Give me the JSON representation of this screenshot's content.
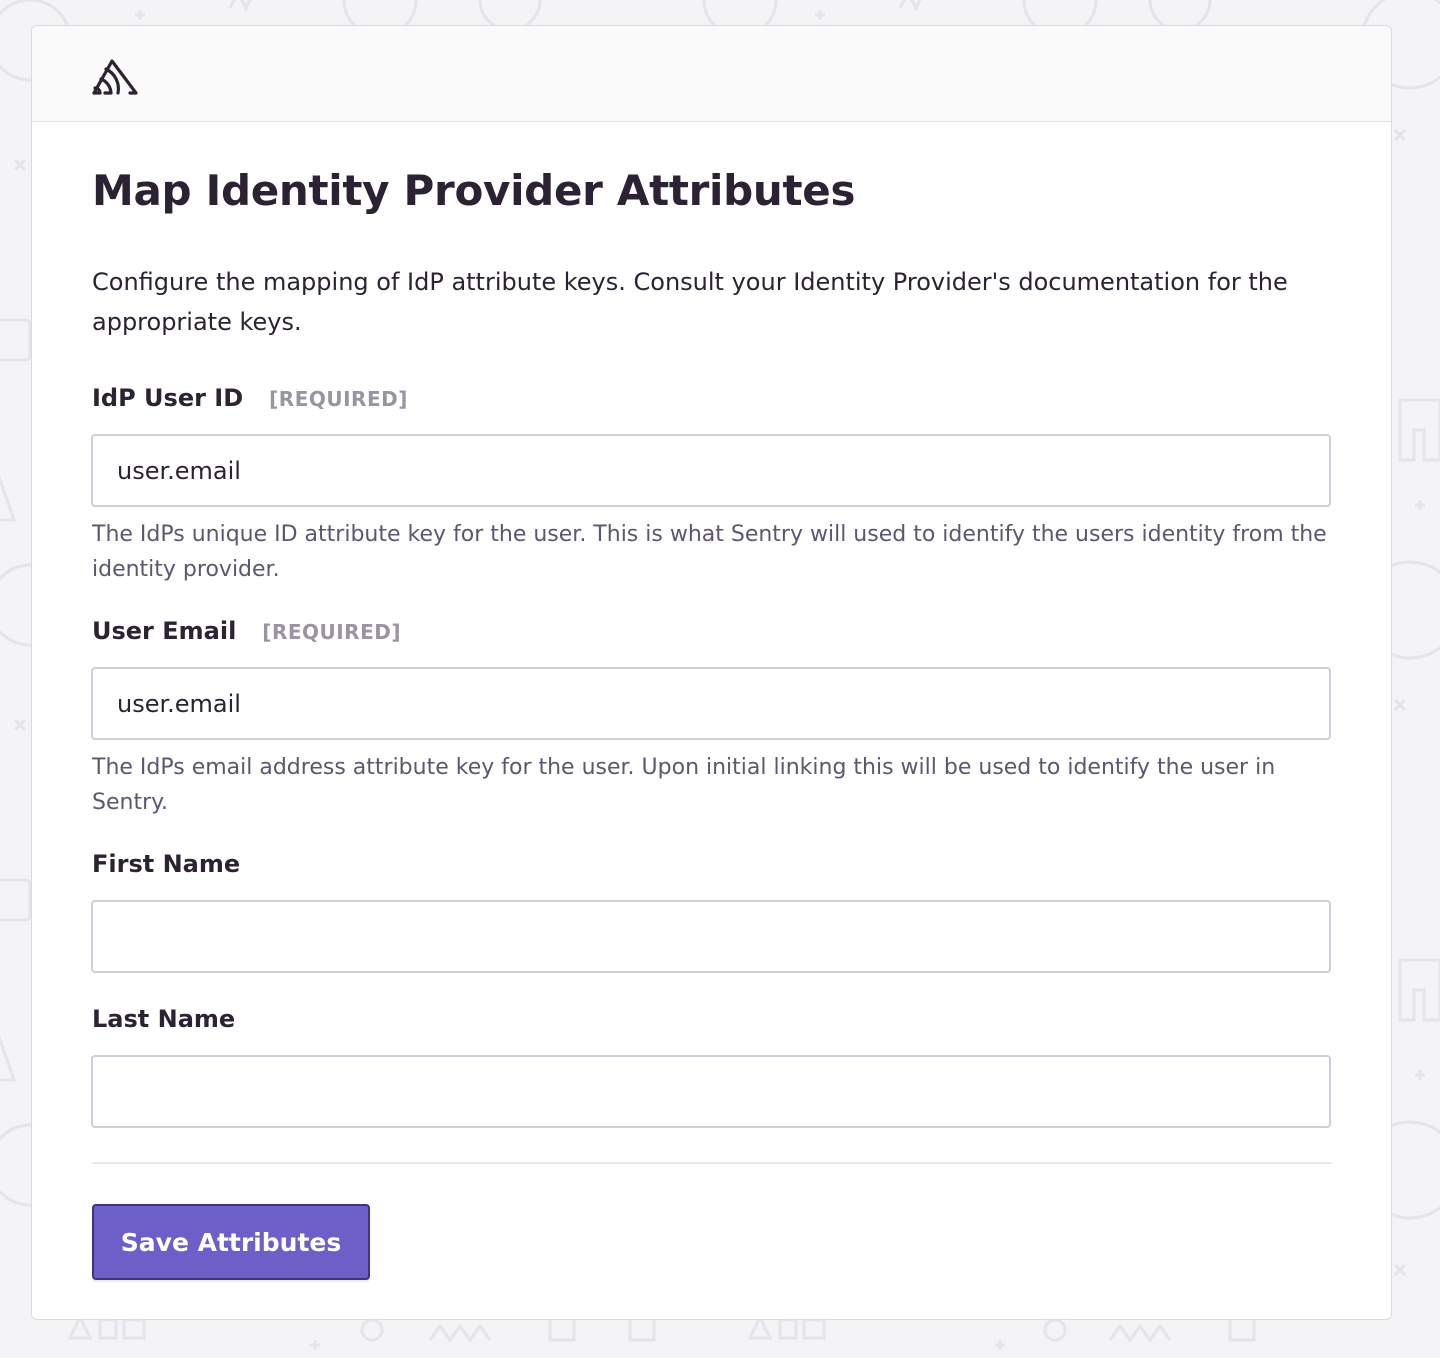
{
  "colors": {
    "accent": "#6c5fc7",
    "accent_border": "#3f3287",
    "text": "#2b2233",
    "muted": "#9a93a3",
    "help": "#5e5670",
    "background": "#f4f3f6"
  },
  "header": {
    "logo_icon": "sentry-logo-icon"
  },
  "page": {
    "title": "Map Identity Provider Attributes",
    "intro": "Configure the mapping of IdP attribute keys. Consult your Identity Provider's documentation for the appropriate keys."
  },
  "fields": [
    {
      "label": "IdP User ID",
      "required_label": "[REQUIRED]",
      "value": "user.email",
      "help": "The IdPs unique ID attribute key for the user. This is what Sentry will used to identify the users identity from the identity provider."
    },
    {
      "label": "User Email",
      "required_label": "[REQUIRED]",
      "value": "user.email",
      "help": "The IdPs email address attribute key for the user. Upon initial linking this will be used to identify the user in Sentry."
    },
    {
      "label": "First Name",
      "value": ""
    },
    {
      "label": "Last Name",
      "value": ""
    }
  ],
  "actions": {
    "save_label": "Save Attributes"
  }
}
